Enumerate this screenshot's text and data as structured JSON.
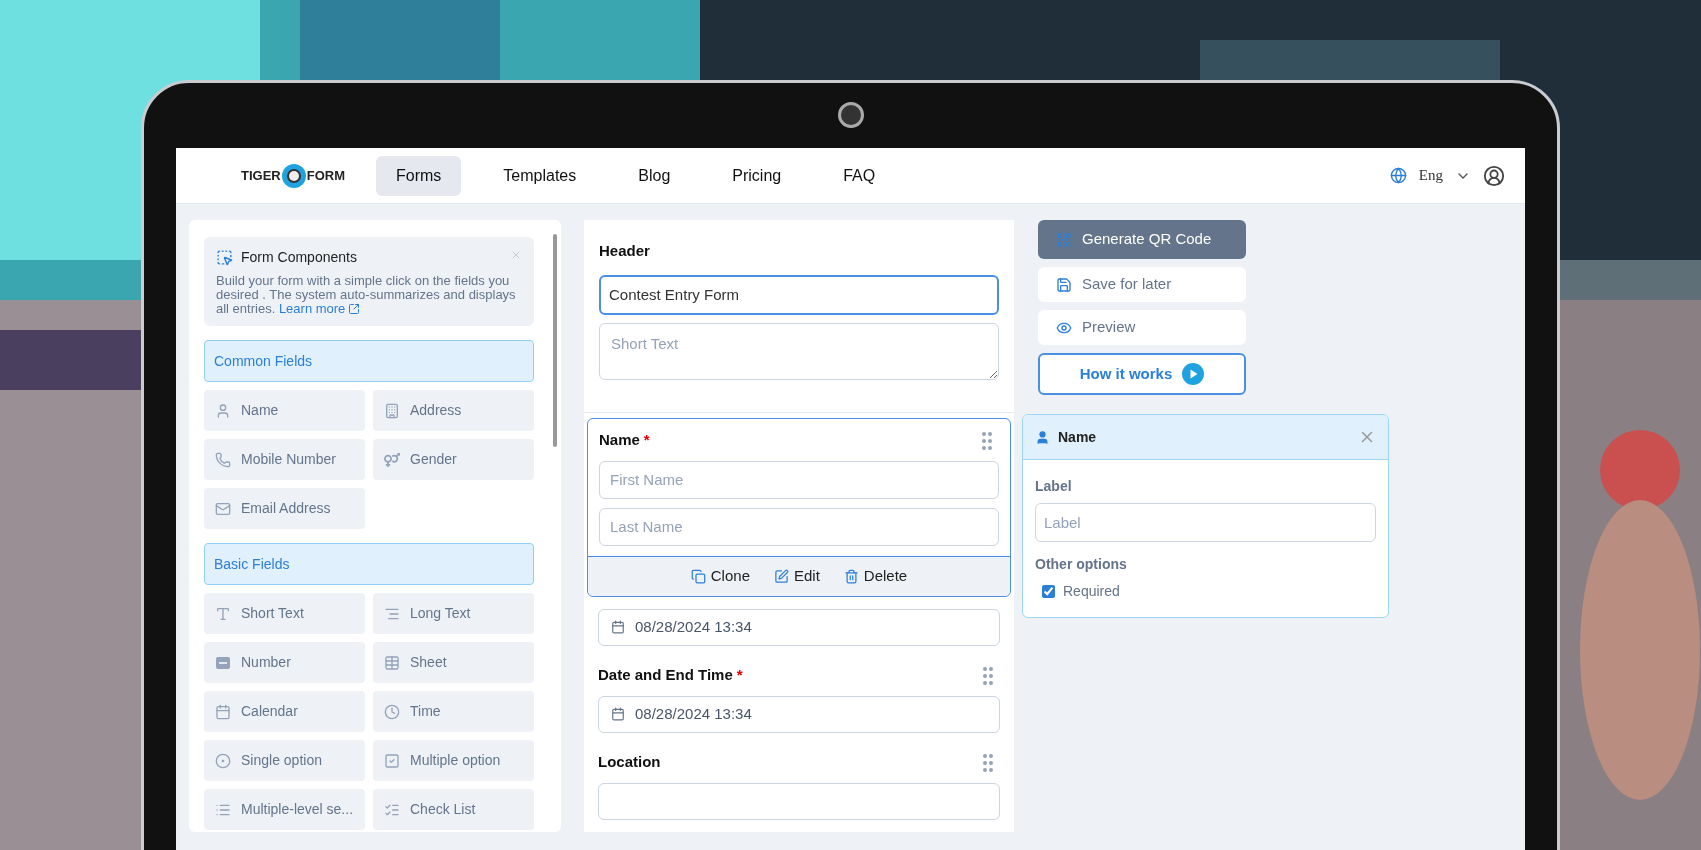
{
  "nav": {
    "logo_left": "TIGER",
    "logo_right": "FORM",
    "links": [
      {
        "label": "Forms",
        "selected": true
      },
      {
        "label": "Templates",
        "selected": false
      },
      {
        "label": "Blog",
        "selected": false
      },
      {
        "label": "Pricing",
        "selected": false
      },
      {
        "label": "FAQ",
        "selected": false
      }
    ],
    "language": "Eng"
  },
  "components_panel": {
    "title": "Form Components",
    "description": "Build your form with a simple click on the fields you desired . The system auto-summarizes and displays all entries.",
    "link": "Learn more",
    "groups": [
      {
        "title": "Common Fields",
        "items": [
          "Name",
          "Address",
          "Mobile Number",
          "Gender",
          "Email Address"
        ]
      },
      {
        "title": "Basic Fields",
        "items": [
          "Short Text",
          "Long Text",
          "Number",
          "Sheet",
          "Calendar",
          "Time",
          "Single option",
          "Multiple option",
          "Multiple-level se...",
          "Check List"
        ]
      }
    ]
  },
  "form": {
    "header": {
      "label": "Header",
      "value": "Contest Entry Form",
      "placeholder": "Short Text"
    },
    "fields": [
      {
        "kind": "name",
        "label": "Name",
        "required_mark": "*",
        "selected": true,
        "inputs": [
          {
            "placeholder": "First Name"
          },
          {
            "placeholder": "Last Name"
          }
        ],
        "actions": [
          "Clone",
          "Edit",
          "Delete"
        ]
      },
      {
        "kind": "datetime",
        "value": "08/28/2024 13:34",
        "selected": false
      },
      {
        "kind": "datetime",
        "label": "Date and End Time",
        "required_mark": "*",
        "value": "08/28/2024 13:34",
        "selected": false
      },
      {
        "kind": "location",
        "label": "Location",
        "selected": false
      }
    ]
  },
  "actions": [
    {
      "kind": "primary",
      "label": "Generate QR Code"
    },
    {
      "kind": "plain",
      "label": "Save for later"
    },
    {
      "kind": "plain",
      "label": "Preview"
    },
    {
      "kind": "outline",
      "label": "How it works"
    }
  ],
  "properties": {
    "title": "Name",
    "label_heading": "Label",
    "label_placeholder": "Label",
    "options_heading": "Other options",
    "options": [
      {
        "label": "Required",
        "checked": true
      }
    ]
  }
}
